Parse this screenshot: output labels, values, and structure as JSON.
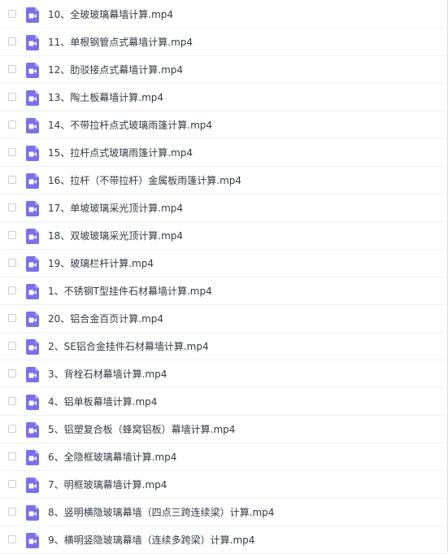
{
  "file_list": {
    "icon": "video-file-icon",
    "icon_color": "#7b70e9",
    "items": [
      {
        "name": "10、全玻玻璃幕墙计算.mp4"
      },
      {
        "name": "11、单根钢管点式幕墙计算.mp4"
      },
      {
        "name": "12、肋驳接点式幕墙计算.mp4"
      },
      {
        "name": "13、陶土板幕墙计算.mp4"
      },
      {
        "name": "14、不带拉杆点式玻璃雨篷计算.mp4"
      },
      {
        "name": "15、拉杆点式玻璃雨篷计算.mp4"
      },
      {
        "name": "16、拉杆（不带拉杆）金属板雨篷计算.mp4"
      },
      {
        "name": "17、单坡玻璃采光顶计算.mp4"
      },
      {
        "name": "18、双坡玻璃采光顶计算.mp4"
      },
      {
        "name": "19、玻璃栏杆计算.mp4"
      },
      {
        "name": "1、不锈钢T型挂件石材幕墙计算.mp4"
      },
      {
        "name": "20、铝合金百页计算.mp4"
      },
      {
        "name": "2、SE铝合金挂件石材幕墙计算.mp4"
      },
      {
        "name": "3、背栓石材幕墙计算.mp4"
      },
      {
        "name": "4、铝单板幕墙计算.mp4"
      },
      {
        "name": "5、铝塑复合板（蜂窝铝板）幕墙计算.mp4"
      },
      {
        "name": "6、全隐框玻璃幕墙计算.mp4"
      },
      {
        "name": "7、明框玻璃幕墙计算.mp4"
      },
      {
        "name": "8、竖明横隐玻璃幕墙（四点三跨连续梁）计算.mp4"
      },
      {
        "name": "9、横明竖隐玻璃幕墙（连续多跨梁）计算.mp4"
      }
    ]
  }
}
